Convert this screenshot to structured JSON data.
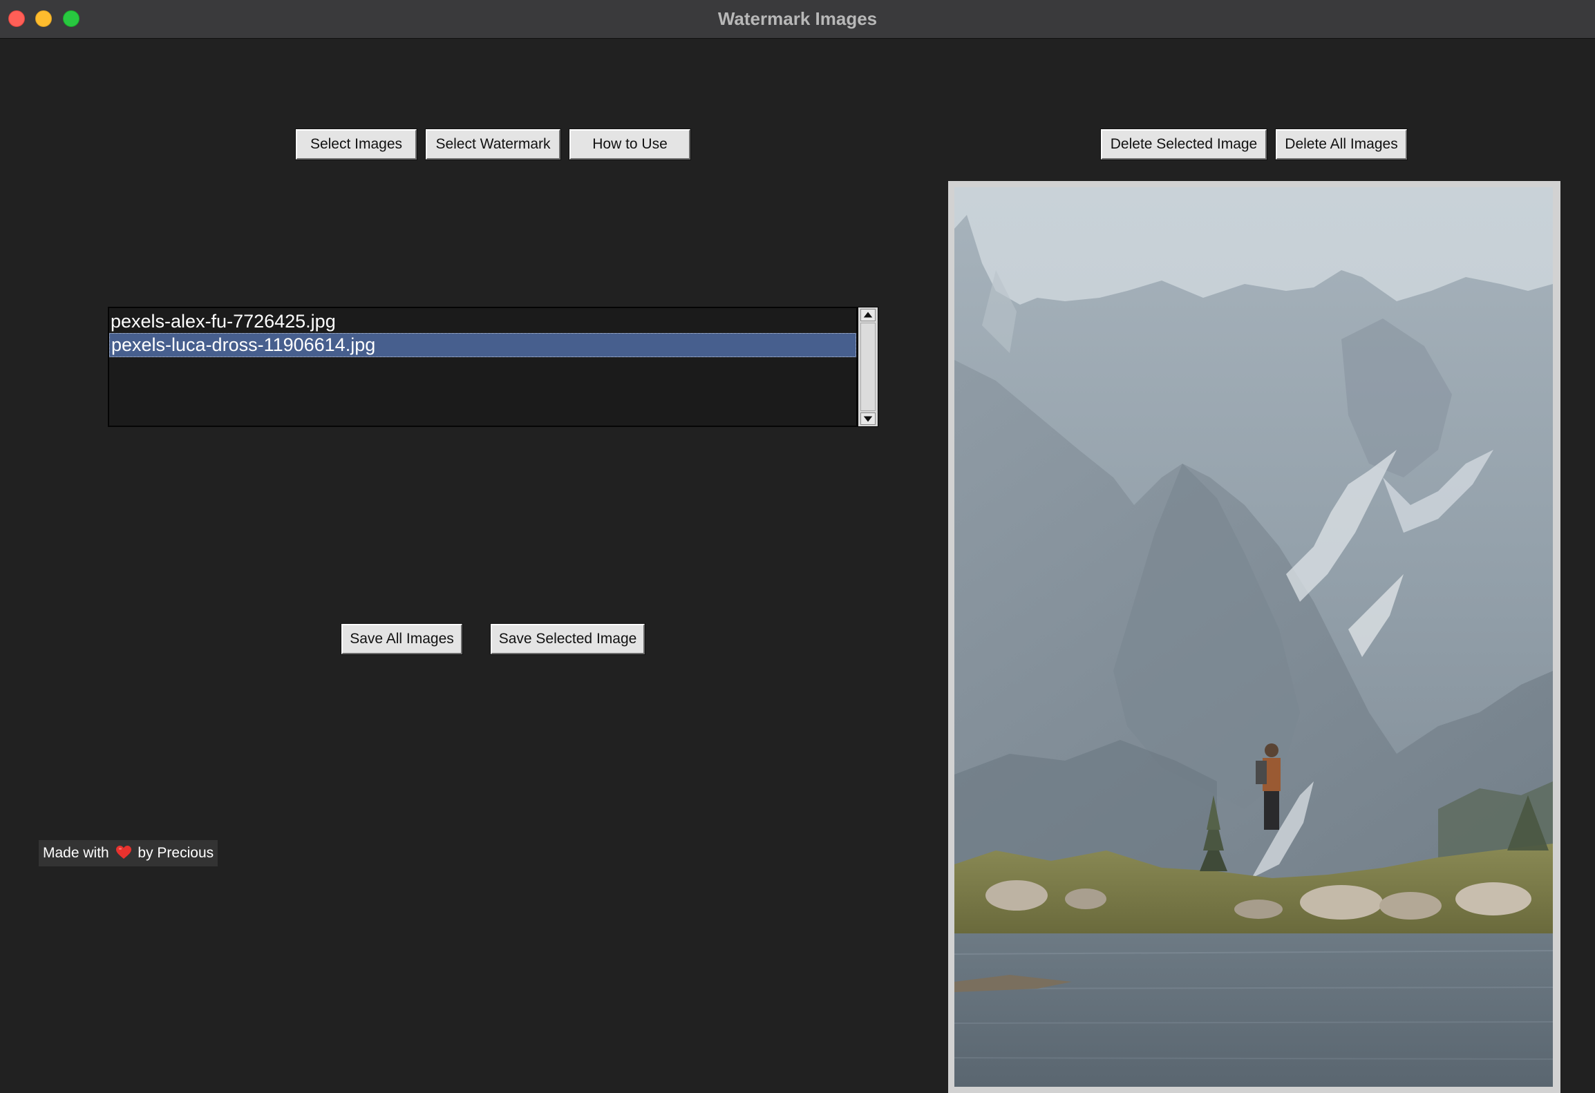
{
  "window": {
    "title": "Watermark Images"
  },
  "toolbar_left": {
    "select_images": "Select Images",
    "select_watermark": "Select Watermark",
    "how_to_use": "How to Use"
  },
  "toolbar_right": {
    "delete_selected": "Delete Selected Image",
    "delete_all": "Delete All Images"
  },
  "file_list": {
    "items": [
      {
        "name": "pexels-alex-fu-7726425.jpg",
        "selected": false
      },
      {
        "name": "pexels-luca-dross-11906614.jpg",
        "selected": true
      }
    ]
  },
  "save_buttons": {
    "save_all": "Save All Images",
    "save_selected": "Save Selected Image"
  },
  "credit": {
    "prefix": "Made with",
    "icon": "heart-icon",
    "suffix": "by Precious"
  },
  "preview": {
    "image": "mountain-lake-hiker-photo"
  },
  "colors": {
    "background": "#212121",
    "titlebar": "#3a3a3c",
    "selection": "#475f8e",
    "button": "#e4e4e4",
    "heart": "#e8322e"
  }
}
